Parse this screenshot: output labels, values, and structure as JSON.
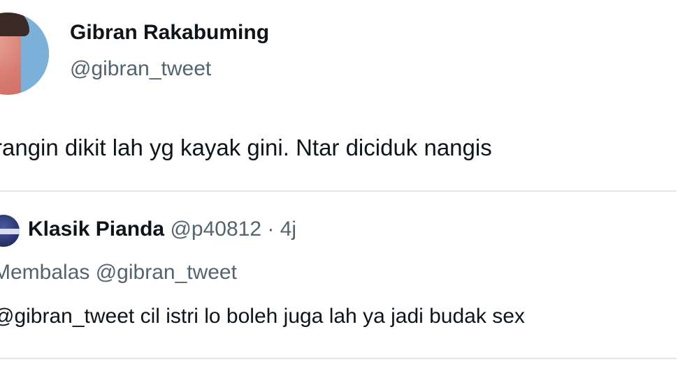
{
  "tweet": {
    "author_name": "Gibran Rakabuming",
    "author_handle": "@gibran_tweet",
    "text": "rangin dikit lah yg kayak gini. Ntar diciduk nangis"
  },
  "quoted_tweet": {
    "author_name": "Klasik Pianda",
    "author_handle": "@p40812",
    "separator": "·",
    "time_ago": "4j",
    "reply_to": "Membalas @gibran_tweet",
    "text": "@gibran_tweet cil istri lo boleh juga lah ya jadi budak sex"
  }
}
